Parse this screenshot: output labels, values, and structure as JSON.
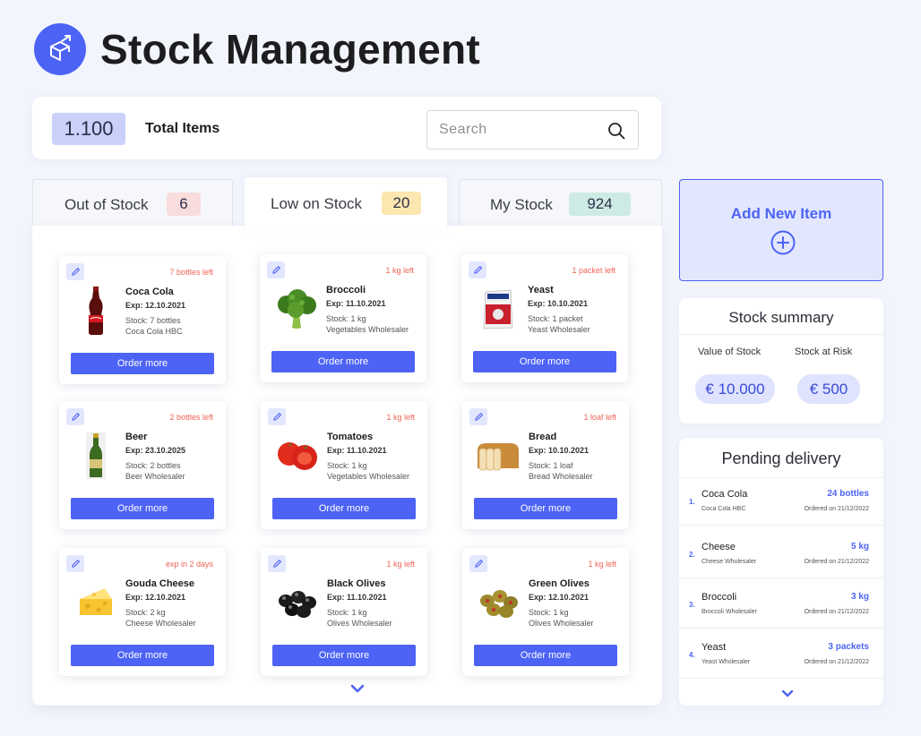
{
  "app": {
    "title": "Stock Management",
    "logo_icon": "box-arrow-icon"
  },
  "toolbar": {
    "total_value": "1.100",
    "total_label": "Total Items",
    "search_placeholder": "Search",
    "search_icon": "search-icon"
  },
  "tabs": [
    {
      "label": "Out of Stock",
      "count": "6",
      "count_color": "#f9dcdc"
    },
    {
      "label": "Low on Stock",
      "count": "20",
      "count_color": "#fde7b1",
      "active": true
    },
    {
      "label": "My Stock",
      "count": "924",
      "count_color": "#cdebe4"
    }
  ],
  "items": [
    {
      "name": "Coca Cola",
      "exp": "Exp: 12.10.2021",
      "stock": "Stock: 7 bottles",
      "vendor": "Coca Cola HBC",
      "alert": "7 bottles left",
      "order_label": "Order more",
      "image": "coca-cola-bottle-icon"
    },
    {
      "name": "Broccoli",
      "exp": "Exp: 11.10.2021",
      "stock": "Stock: 1 kg",
      "vendor": "Vegetables Wholesaler",
      "alert": "1 kg left",
      "order_label": "Order more",
      "image": "broccoli-icon"
    },
    {
      "name": "Yeast",
      "exp": "Exp: 10.10.2021",
      "stock": "Stock: 1 packet",
      "vendor": "Yeast Wholesaler",
      "alert": "1 packet left",
      "order_label": "Order more",
      "image": "yeast-packet-icon"
    },
    {
      "name": "Beer",
      "exp": "Exp: 23.10.2025",
      "stock": "Stock: 2 bottles",
      "vendor": "Beer Wholesaler",
      "alert": "2 bottles left",
      "order_label": "Order more",
      "image": "beer-bottle-icon"
    },
    {
      "name": "Tomatoes",
      "exp": "Exp: 11.10.2021",
      "stock": "Stock: 1 kg",
      "vendor": "Vegetables Wholesaler",
      "alert": "1 kg left",
      "order_label": "Order more",
      "image": "tomatoes-icon"
    },
    {
      "name": "Bread",
      "exp": "Exp: 10.10.2021",
      "stock": "Stock: 1 loaf",
      "vendor": "Bread Wholesaler",
      "alert": "1 loaf left",
      "order_label": "Order more",
      "image": "bread-loaf-icon"
    },
    {
      "name": "Gouda Cheese",
      "exp": "Exp: 12.10.2021",
      "stock": "Stock: 2 kg",
      "vendor": "Cheese Wholesaler",
      "alert": "exp in 2 days",
      "order_label": "Order more",
      "image": "cheese-icon"
    },
    {
      "name": "Black Olives",
      "exp": "Exp: 11.10.2021",
      "stock": "Stock: 1 kg",
      "vendor": "Olives Wholesaler",
      "alert": "1 kg left",
      "order_label": "Order more",
      "image": "black-olives-icon"
    },
    {
      "name": "Green Olives",
      "exp": "Exp: 12.10.2021",
      "stock": "Stock: 1 kg",
      "vendor": "Olives Wholesaler",
      "alert": "1 kg left",
      "order_label": "Order more",
      "image": "green-olives-icon"
    }
  ],
  "add_item": {
    "label": "Add New Item",
    "icon": "plus-circle-icon"
  },
  "summary": {
    "title": "Stock summary",
    "value_label": "Value of Stock",
    "value": "€ 10.000",
    "risk_label": "Stock at Risk",
    "risk": "€ 500"
  },
  "pending": {
    "title": "Pending delivery",
    "rows": [
      {
        "num": "1.",
        "name": "Coca Cola",
        "vendor": "Coca Cola HBC",
        "qty": "24 bottles",
        "date": "Ordered on 21/12/2022"
      },
      {
        "num": "2.",
        "name": "Cheese",
        "vendor": "Cheese Wholesaler",
        "qty": "5 kg",
        "date": "Ordered on 21/12/2022"
      },
      {
        "num": "3.",
        "name": "Broccoli",
        "vendor": "Broccoli Wholesaler",
        "qty": "3 kg",
        "date": "Ordered on 21/12/2022"
      },
      {
        "num": "4.",
        "name": "Yeast",
        "vendor": "Yeast Wholesaler",
        "qty": "3 packets",
        "date": "Ordered on 21/12/2022"
      }
    ]
  },
  "colors": {
    "accent": "#4d63f5",
    "alert": "#ef6357",
    "background": "#f3f5fd"
  }
}
